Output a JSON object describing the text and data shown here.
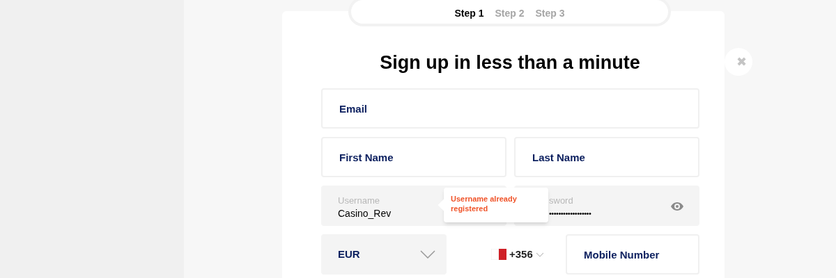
{
  "steps": [
    {
      "label": "Step 1",
      "selected": true
    },
    {
      "label": "Step 2",
      "selected": false
    },
    {
      "label": "Step 3",
      "selected": false
    }
  ],
  "title": "Sign up in less than a minute",
  "close": "✖",
  "email": {
    "placeholder": "Email"
  },
  "first_name": {
    "placeholder": "First Name"
  },
  "last_name": {
    "placeholder": "Last Name"
  },
  "username": {
    "label": "Username",
    "value": "Casino_Rev",
    "error": "Username already registered"
  },
  "password": {
    "label": "sword",
    "value": "••••••••••••••••••"
  },
  "currency": {
    "value": "EUR"
  },
  "phone_code": {
    "value": "+356"
  },
  "mobile": {
    "placeholder": "Mobile Number"
  }
}
